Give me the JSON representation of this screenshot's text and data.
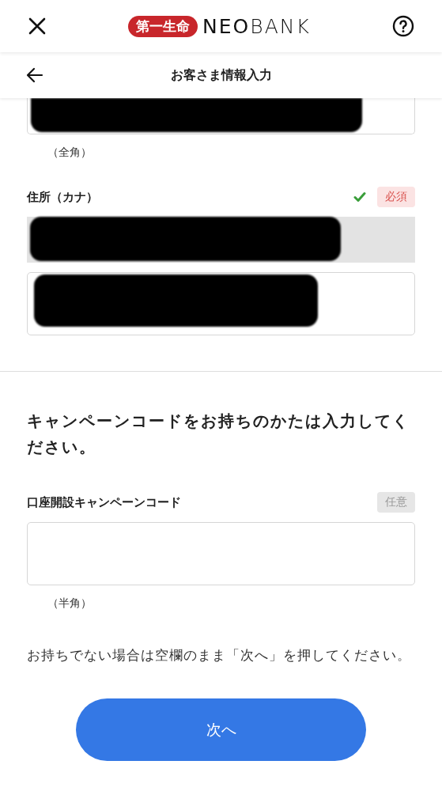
{
  "header": {
    "logo_badge": "第一生命",
    "logo_text": "**NEO**BANK"
  },
  "title_bar": {
    "title": "お客さま情報入力"
  },
  "name_field": {
    "redacted": true,
    "note": "（全角）"
  },
  "address_kana": {
    "label": "住所（カナ）",
    "valid": true,
    "badge": {
      "text": "必須",
      "kind": "required"
    },
    "inputs": [
      {
        "readonly": true,
        "redacted": true
      },
      {
        "readonly": false,
        "redacted": true
      }
    ]
  },
  "campaign": {
    "heading": "キャンペーンコードをお持ちのかたは入力してください。",
    "label": "口座開設キャンペーンコード",
    "badge": {
      "text": "任意",
      "kind": "optional"
    },
    "input": {
      "readonly": false,
      "redacted": false
    },
    "note": "（半角）",
    "hint": "お持ちでない場合は空欄のまま「次へ」を押してください。"
  },
  "next_button": {
    "label": "次へ"
  }
}
